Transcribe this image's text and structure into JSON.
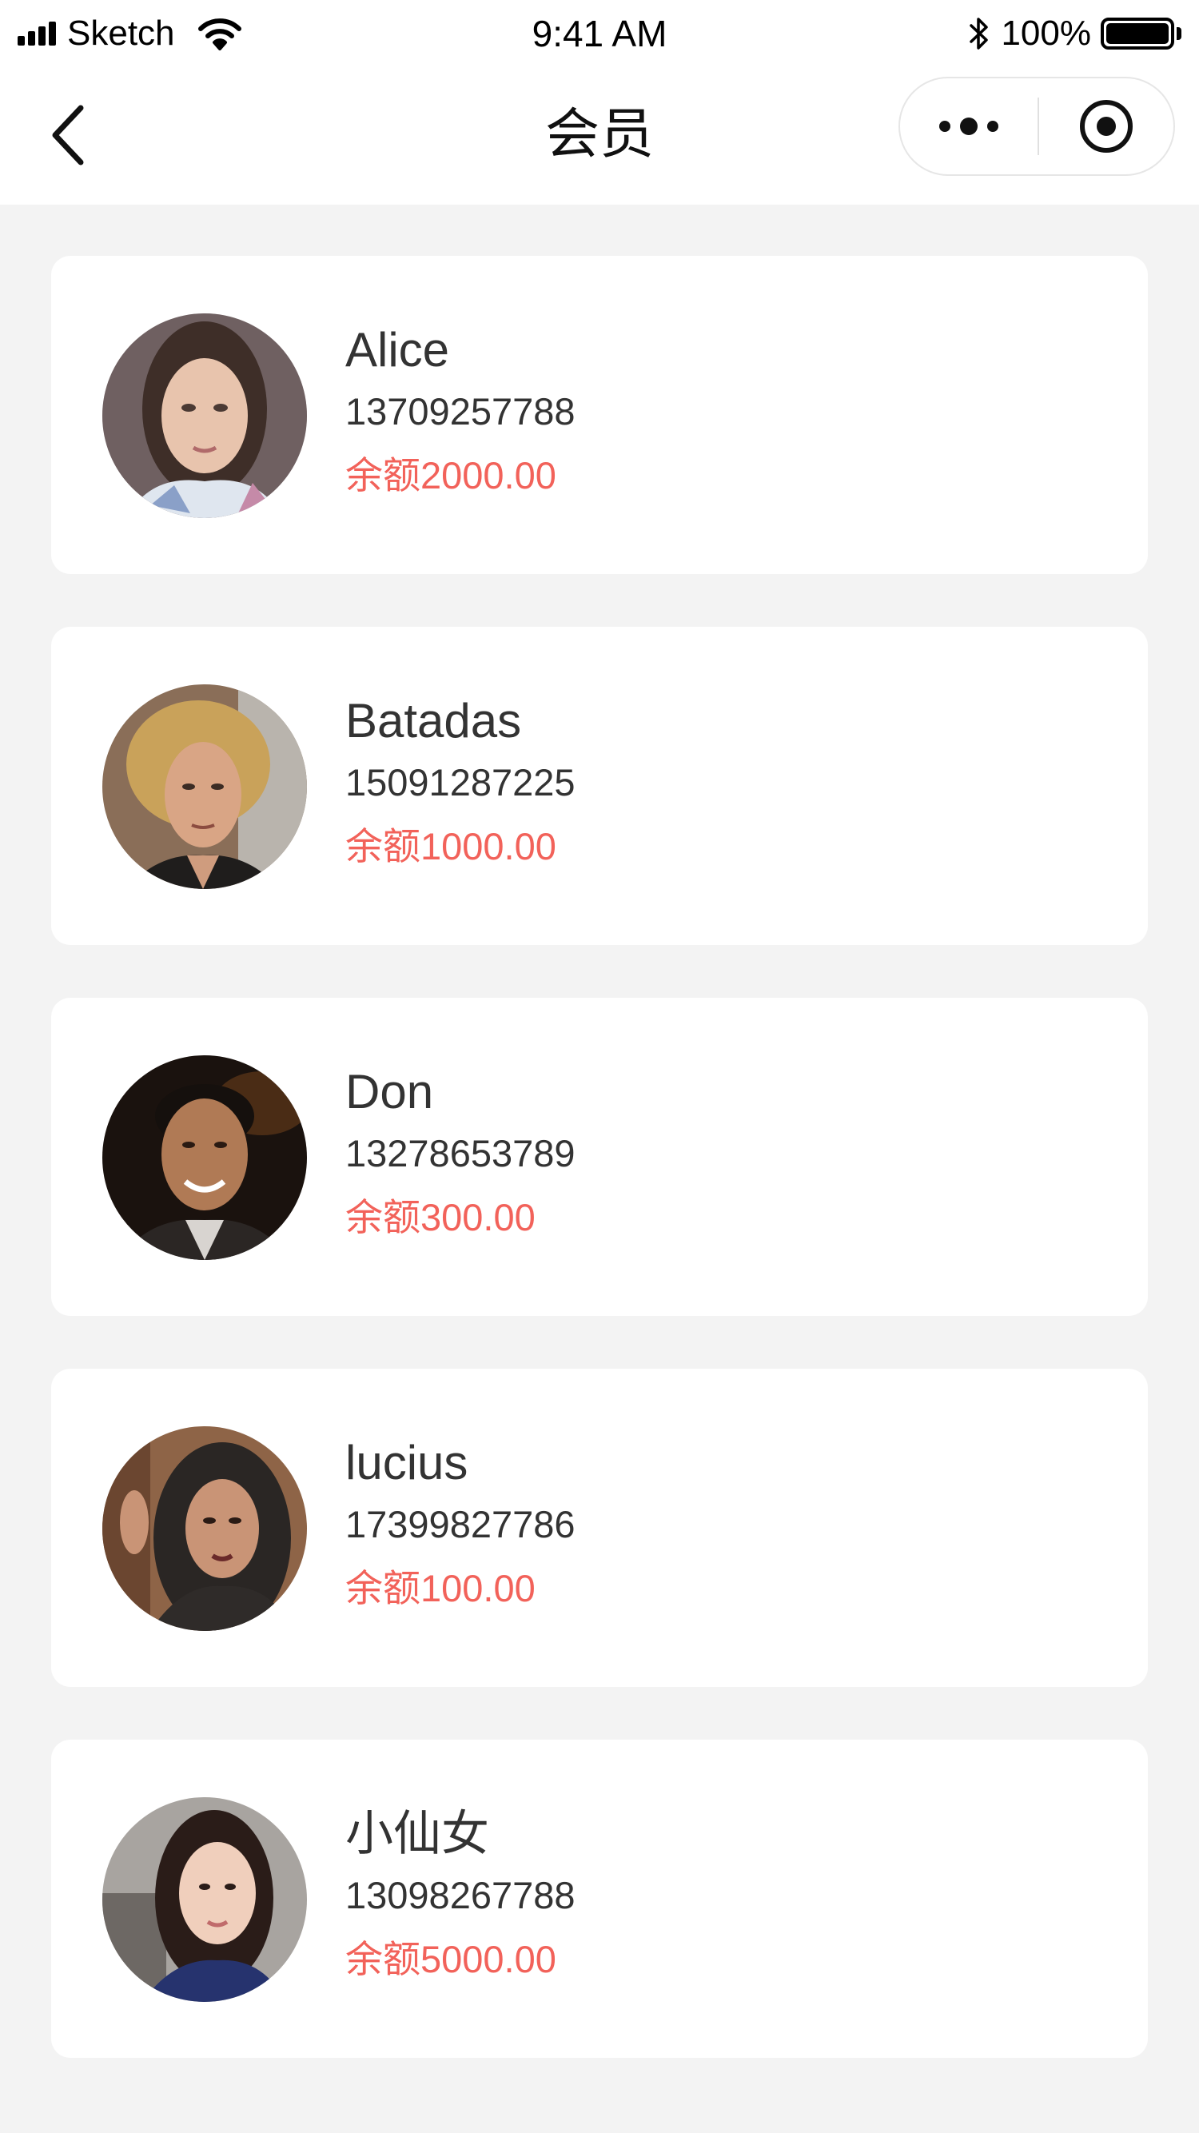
{
  "status_bar": {
    "carrier": "Sketch",
    "time": "9:41 AM",
    "battery_percent": "100%"
  },
  "nav": {
    "title": "会员",
    "back_icon": "chevron-left-icon",
    "more_icon": "more-dots-icon",
    "close_icon": "target-circle-icon"
  },
  "colors": {
    "balance": "#f2625a",
    "background": "#f3f3f3",
    "card": "#ffffff"
  },
  "members": [
    {
      "name": "Alice",
      "phone": "13709257788",
      "balance": "余额2000.00"
    },
    {
      "name": "Batadas",
      "phone": "15091287225",
      "balance": "余额1000.00"
    },
    {
      "name": "Don",
      "phone": "13278653789",
      "balance": "余额300.00"
    },
    {
      "name": "lucius",
      "phone": "17399827786",
      "balance": "余额100.00"
    },
    {
      "name": "小仙女",
      "phone": "13098267788",
      "balance": "余额5000.00"
    }
  ]
}
